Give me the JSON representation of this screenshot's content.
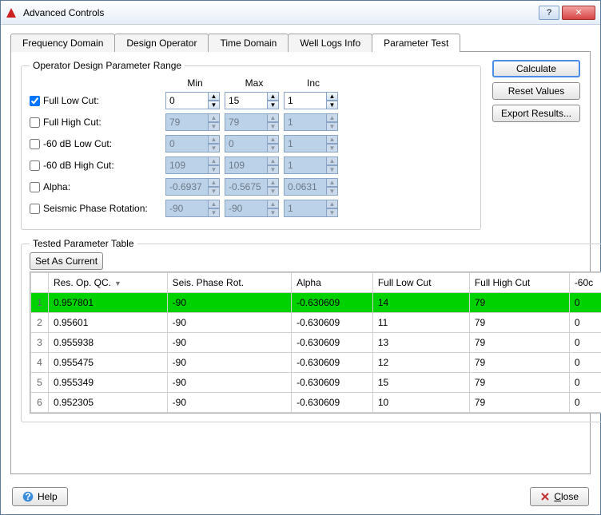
{
  "window": {
    "title": "Advanced Controls"
  },
  "tabs": [
    "Frequency Domain",
    "Design Operator",
    "Time Domain",
    "Well Logs Info",
    "Parameter Test"
  ],
  "activeTab": 4,
  "group": {
    "title": "Operator Design Parameter Range",
    "cols": {
      "min": "Min",
      "max": "Max",
      "inc": "Inc"
    },
    "rows": [
      {
        "label": "Full Low Cut:",
        "checked": true,
        "min": "0",
        "max": "15",
        "inc": "1"
      },
      {
        "label": "Full High Cut:",
        "checked": false,
        "min": "79",
        "max": "79",
        "inc": "1"
      },
      {
        "label": "-60 dB Low Cut:",
        "checked": false,
        "min": "0",
        "max": "0",
        "inc": "1"
      },
      {
        "label": "-60 dB High Cut:",
        "checked": false,
        "min": "109",
        "max": "109",
        "inc": "1"
      },
      {
        "label": "Alpha:",
        "checked": false,
        "min": "-0.6937",
        "max": "-0.5675",
        "inc": "0.0631"
      },
      {
        "label": "Seismic Phase Rotation:",
        "checked": false,
        "min": "-90",
        "max": "-90",
        "inc": "1"
      }
    ]
  },
  "buttons": {
    "calculate": "Calculate",
    "reset": "Reset Values",
    "export": "Export Results...",
    "setCurrent": "Set As Current",
    "help": "Help",
    "close": "Close"
  },
  "table": {
    "title": "Tested Parameter Table",
    "columns": [
      "Res. Op. QC.",
      "Seis. Phase Rot.",
      "Alpha",
      "Full Low Cut",
      "Full High Cut",
      "-60c"
    ],
    "sortCol": 0,
    "rows": [
      {
        "n": "1",
        "sel": true,
        "c": [
          "0.957801",
          "-90",
          "-0.630609",
          "14",
          "79",
          "0"
        ]
      },
      {
        "n": "2",
        "sel": false,
        "c": [
          "0.95601",
          "-90",
          "-0.630609",
          "11",
          "79",
          "0"
        ]
      },
      {
        "n": "3",
        "sel": false,
        "c": [
          "0.955938",
          "-90",
          "-0.630609",
          "13",
          "79",
          "0"
        ]
      },
      {
        "n": "4",
        "sel": false,
        "c": [
          "0.955475",
          "-90",
          "-0.630609",
          "12",
          "79",
          "0"
        ]
      },
      {
        "n": "5",
        "sel": false,
        "c": [
          "0.955349",
          "-90",
          "-0.630609",
          "15",
          "79",
          "0"
        ]
      },
      {
        "n": "6",
        "sel": false,
        "c": [
          "0.952305",
          "-90",
          "-0.630609",
          "10",
          "79",
          "0"
        ]
      }
    ]
  }
}
